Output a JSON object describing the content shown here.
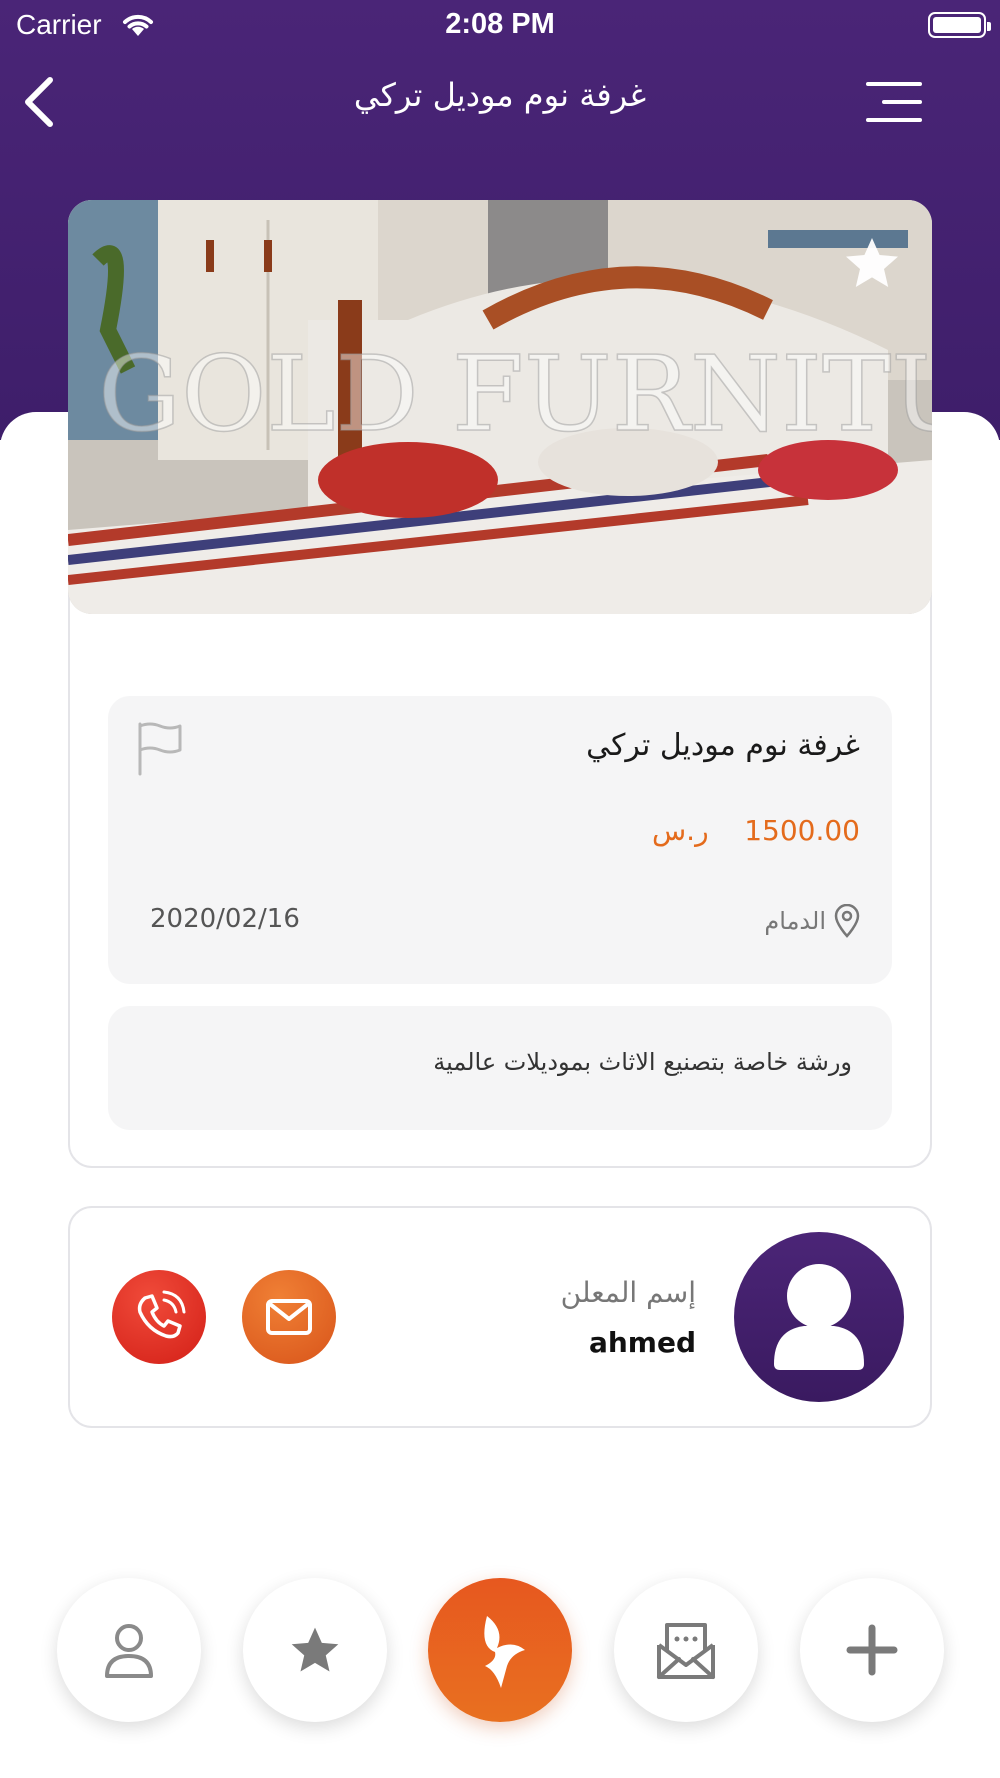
{
  "status_bar": {
    "carrier": "Carrier",
    "time": "2:08 PM"
  },
  "header": {
    "title": "غرفة نوم موديل تركي"
  },
  "photo": {
    "watermark": "GOLD FURNITU"
  },
  "product": {
    "name": "غرفة نوم موديل تركي",
    "price": "1500.00",
    "currency": "ر.س",
    "location": "الدمام",
    "date": "2020/02/16",
    "description": "ورشة خاصة بتصنيع الاثاث بموديلات عالمية"
  },
  "seller": {
    "label": "إسم المعلن",
    "name": "ahmed"
  },
  "colors": {
    "header_purple": "#4a2577",
    "accent_orange": "#e46b1c",
    "call_red": "#d31f17"
  },
  "icons": {
    "back": "chevron-left-icon",
    "menu": "menu-icon",
    "favorite": "star-icon",
    "report": "flag-icon",
    "location": "location-pin-icon",
    "call": "phone-icon",
    "mail": "mail-icon",
    "avatar": "user-icon"
  },
  "bottom_nav": [
    "profile-icon",
    "favorites-icon",
    "home-logo-icon",
    "messages-icon",
    "add-icon"
  ]
}
